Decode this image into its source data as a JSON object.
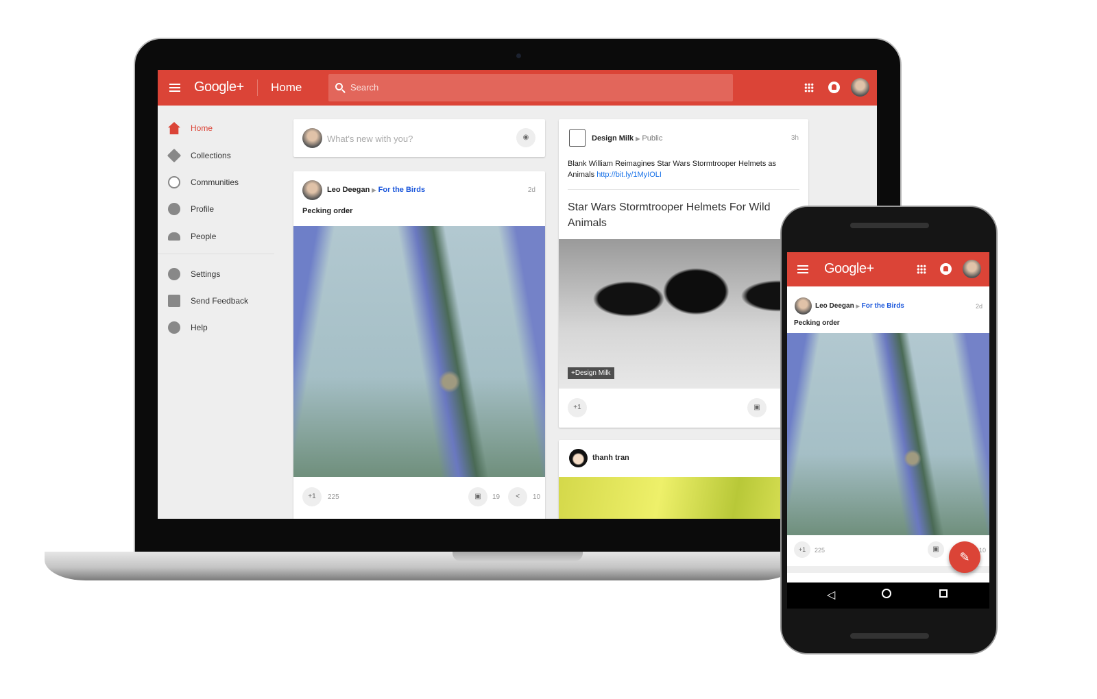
{
  "colors": {
    "accent": "#db4437",
    "link": "#1a56db"
  },
  "desktop": {
    "header": {
      "logo": "Google+",
      "page_title": "Home",
      "search_placeholder": "Search",
      "icons": [
        "menu-icon",
        "search-icon",
        "apps-grid-icon",
        "notifications-bell-icon",
        "account-avatar"
      ]
    },
    "sidebar": {
      "items": [
        {
          "label": "Home",
          "icon": "home-icon",
          "active": true
        },
        {
          "label": "Collections",
          "icon": "collections-icon"
        },
        {
          "label": "Communities",
          "icon": "communities-icon"
        },
        {
          "label": "Profile",
          "icon": "profile-icon"
        },
        {
          "label": "People",
          "icon": "people-icon"
        },
        {
          "label": "Settings",
          "icon": "gear-icon"
        },
        {
          "label": "Send Feedback",
          "icon": "feedback-icon"
        },
        {
          "label": "Help",
          "icon": "help-icon"
        }
      ]
    },
    "composer": {
      "placeholder": "What's new with you?",
      "icon": "camera-icon"
    },
    "post1": {
      "author": "Leo Deegan",
      "collection": "For the Birds",
      "time": "2d",
      "title": "Pecking order",
      "plus_one": "+1",
      "plus_count": "225",
      "comment_count": "19",
      "share_count": "10"
    },
    "post2": {
      "author": "Design Milk",
      "visibility": "Public",
      "time": "3h",
      "text": "Blank William Reimagines Star Wars Stormtrooper Helmets as Animals",
      "url": "http://bit.ly/1MyIOLI",
      "link_title": "Star Wars Stormtrooper Helmets For Wild Animals",
      "image_tag": "+Design Milk",
      "plus_one": "+1"
    },
    "post3": {
      "author": "thanh tran"
    }
  },
  "mobile": {
    "header": {
      "logo": "Google+"
    },
    "post": {
      "author": "Leo Deegan",
      "collection": "For the Birds",
      "time": "2d",
      "title": "Pecking order",
      "plus_one": "+1",
      "plus_count": "225",
      "share_count": "10"
    },
    "fab_icon": "pencil-icon",
    "nav": [
      "back-icon",
      "home-circle-icon",
      "recents-square-icon"
    ]
  }
}
